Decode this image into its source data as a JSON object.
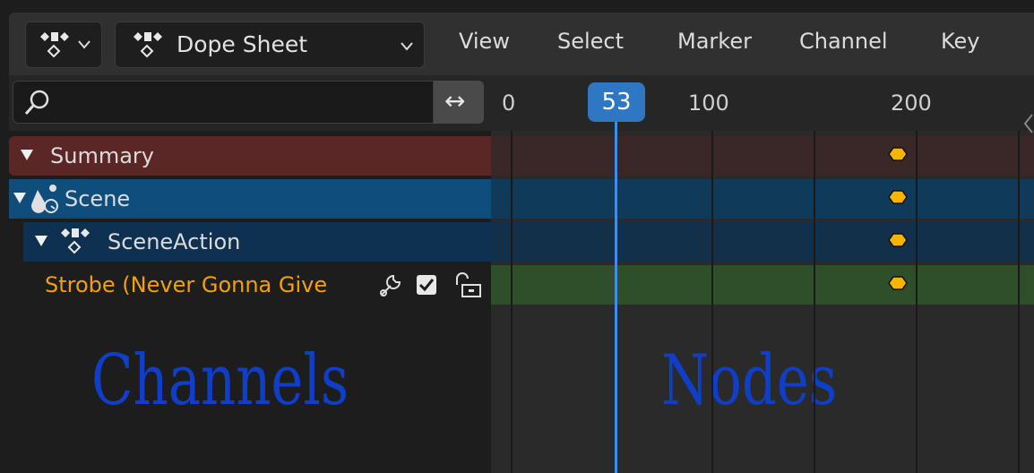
{
  "header": {
    "editor_type_icon": "dope-sheet-icon",
    "mode_icon": "dope-sheet-icon",
    "mode_label": "Dope Sheet",
    "menus": [
      "View",
      "Select",
      "Marker",
      "Channel",
      "Key"
    ]
  },
  "toolbar": {
    "search_placeholder": "",
    "swap_icon": "↔"
  },
  "timeline": {
    "ticks": [
      "0",
      "100",
      "200"
    ],
    "current_frame": "53",
    "keyframe_frame": 200
  },
  "channels": {
    "summary": "Summary",
    "scene": "Scene",
    "action": "SceneAction",
    "strobe": "Strobe (Never Gonna Give"
  },
  "annotations": {
    "left": "Channels",
    "right": "Nodes"
  },
  "colors": {
    "summary_row": "#5a2626",
    "scene_row": "#0f4d7d",
    "action_row": "#0f3151",
    "strobe_row": "#2f4f2b",
    "keyframe": "#f7b500",
    "playhead": "#2f77c3",
    "annotation": "#0f3fc8",
    "strobe_text": "#f5a000"
  }
}
